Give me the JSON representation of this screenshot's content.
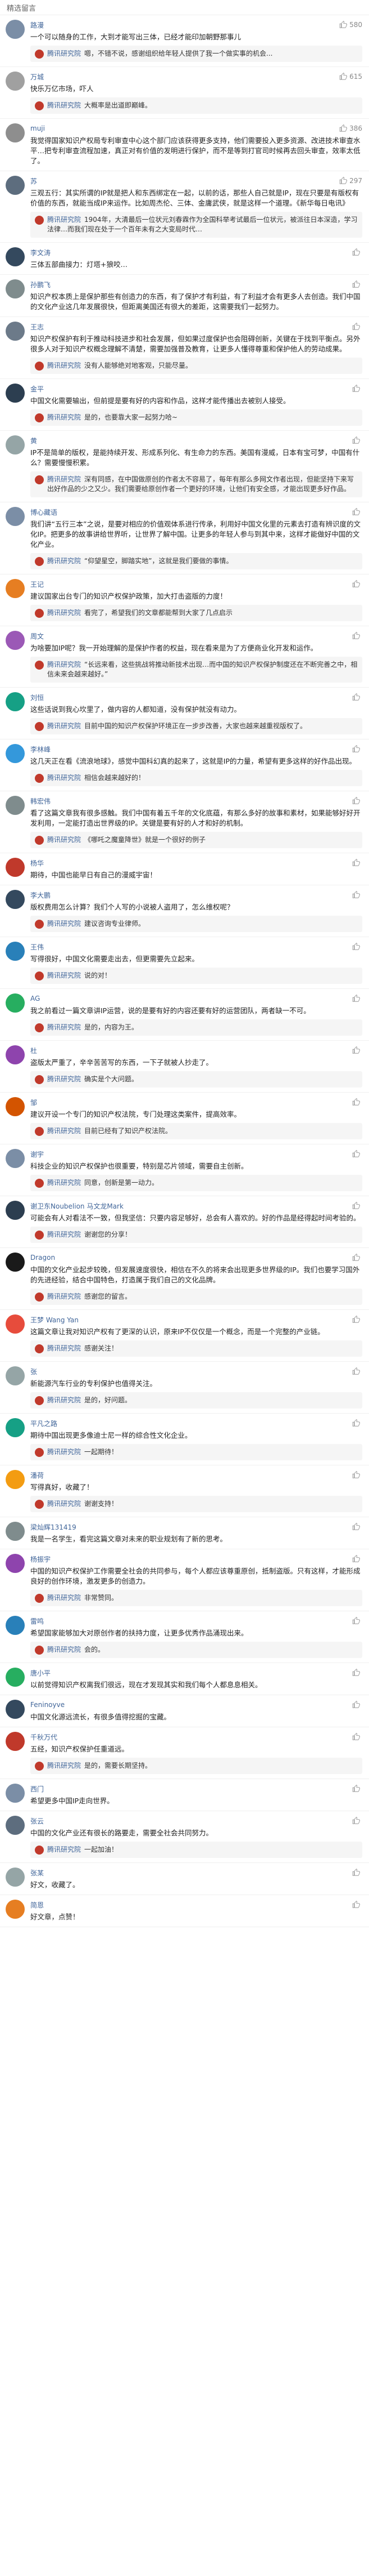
{
  "header": {
    "title": "精选留言"
  },
  "comments": [
    {
      "user": "路漫",
      "likes": "580",
      "text": "一个可以随身的工作，大到才能写出三体，已经才能印加朝野那事儿",
      "avatar_color": "#7b8ea6",
      "replies": [
        {
          "name": "腾讯研究院",
          "badge": "",
          "text": "嗯，不错不说，感谢组织给年轻人提供了我一个做实事的机会...",
          "avatar_color": "#c0392b"
        }
      ]
    },
    {
      "user": "万城",
      "likes": "615",
      "text": "快乐万亿市场，吓人",
      "avatar_color": "#a0a0a0",
      "replies": [
        {
          "name": "腾讯研究院",
          "badge": "",
          "text": "大概率是出道即巅峰。",
          "avatar_color": "#c0392b"
        }
      ]
    },
    {
      "user": "muji",
      "likes": "386",
      "text": "我觉得国家知识产权局专利审查中心这个部门应该获得更多支持，他们需要投入更多资源、改进技术审查水平…把专利审查流程加速，真正对有价值的发明进行保护，而不是等到打官司时候再去回头审查，效率太低了。",
      "avatar_color": "#8e8e8e",
      "replies": []
    },
    {
      "user": "苏",
      "likes": "297",
      "text": "三观五行：其实所谓的IP就是把人和东西绑定在一起，以前的话，那些人自己就是IP，现在只要是有版权有价值的东西，就能当成IP来运作。比如周杰伦、三体、金庸武侠，就是这样一个道理。《新华每日电讯》",
      "avatar_color": "#5d6d7e",
      "replies": [
        {
          "name": "腾讯研究院",
          "badge": "",
          "text": "1904年，大清最后一位状元刘春霖作为全国科举考试最后一位状元，被派往日本深造，学习法律…而我们现在处于一个百年未有之大变局时代…",
          "avatar_color": "#c0392b"
        }
      ]
    },
    {
      "user": "李文涛",
      "likes": "",
      "text": "三体五部曲接力：灯塔+狼咬…",
      "avatar_color": "#34495e",
      "replies": []
    },
    {
      "user": "孙鹏飞",
      "likes": "",
      "text": "知识产权本质上是保护那些有创造力的东西，有了保护才有利益，有了利益才会有更多人去创造。我们中国的文化产业这几年发展很快，但距离美国还有很大的差距，这需要我们一起努力。",
      "avatar_color": "#7f8c8d",
      "replies": []
    },
    {
      "user": "王志",
      "likes": "",
      "text": "知识产权保护有利于推动科技进步和社会发展，但如果过度保护也会阻碍创新，关键在于找到平衡点。另外很多人对于知识产权概念理解不清楚，需要加强普及教育，让更多人懂得尊重和保护他人的劳动成果。",
      "avatar_color": "#6c7a89",
      "replies": [
        {
          "name": "腾讯研究院",
          "badge": "",
          "text": "没有人能够绝对地客观，只能尽量。",
          "avatar_color": "#c0392b"
        }
      ]
    },
    {
      "user": "金平",
      "likes": "",
      "text": "中国文化需要输出，但前提是要有好的内容和作品，这样才能传播出去被别人接受。",
      "avatar_color": "#2c3e50",
      "replies": [
        {
          "name": "腾讯研究院",
          "badge": "",
          "text": "是的，也要靠大家一起努力哈~",
          "avatar_color": "#c0392b"
        }
      ]
    },
    {
      "user": "黄",
      "likes": "",
      "text": "IP不是简单的版权，是能持续开发、形成系列化、有生命力的东西。美国有漫威，日本有宝可梦，中国有什么？需要慢慢积累。",
      "avatar_color": "#95a5a6",
      "replies": [
        {
          "name": "腾讯研究院",
          "badge": "",
          "text": "深有同感，在中国做原创的作者太不容易了，每年有那么多网文作者出现，但能坚持下来写出好作品的少之又少。我们需要给原创作者一个更好的环境，让他们有安全感，才能出现更多好作品。",
          "avatar_color": "#c0392b"
        }
      ]
    },
    {
      "user": "博心藏语",
      "likes": "",
      "text": "我们讲“五行三本”之说，是要对相应的价值观体系进行传承，利用好中国文化里的元素去打造有辨识度的文化IP。把更多的故事讲给世界听，让世界了解中国。让更多的年轻人参与到其中来，这样才能做好中国的文化产业。",
      "avatar_color": "#7b8ea6",
      "replies": [
        {
          "name": "腾讯研究院",
          "badge": "",
          "text": "“仰望星空，脚踏实地”，这就是我们要做的事情。",
          "avatar_color": "#c0392b"
        }
      ]
    },
    {
      "user": "王记",
      "likes": "",
      "text": "建议国家出台专门的知识产权保护政策，加大打击盗版的力度！",
      "avatar_color": "#e67e22",
      "replies": [
        {
          "name": "腾讯研究院",
          "badge": "",
          "text": "看完了，希望我们的文章都能帮到大家了几点启示",
          "avatar_color": "#c0392b"
        }
      ]
    },
    {
      "user": "周文",
      "likes": "",
      "text": "为啥要加IP呢？我一开始理解的是保护作者的权益，现在看来是为了方便商业化开发和运作。",
      "avatar_color": "#9b59b6",
      "replies": [
        {
          "name": "腾讯研究院",
          "badge": "",
          "text": "“长远来看，这些挑战将推动新技术出现…而中国的知识产权保护制度还在不断完善之中，相信未来会越来越好。”",
          "avatar_color": "#c0392b"
        }
      ]
    },
    {
      "user": "刘恒",
      "likes": "",
      "text": "这些话说到我心坎里了，做内容的人都知道，没有保护就没有动力。",
      "avatar_color": "#16a085",
      "replies": [
        {
          "name": "腾讯研究院",
          "badge": "",
          "text": "目前中国的知识产权保护环境正在一步步改善，大家也越来越重视版权了。",
          "avatar_color": "#c0392b"
        }
      ]
    },
    {
      "user": "李林峰",
      "likes": "",
      "text": "这几天正在看《流浪地球》，感觉中国科幻真的起来了，这就是IP的力量，希望有更多这样的好作品出现。",
      "avatar_color": "#3498db",
      "replies": [
        {
          "name": "腾讯研究院",
          "badge": "",
          "text": "相信会越来越好的！",
          "avatar_color": "#c0392b"
        }
      ]
    },
    {
      "user": "韩宏伟",
      "likes": "",
      "text": "看了这篇文章我有很多感触。我们中国有着五千年的文化底蕴，有那么多好的故事和素材，如果能够好好开发利用，一定能打造出世界级的IP。关键是要有好的人才和好的机制。",
      "avatar_color": "#7f8c8d",
      "replies": [
        {
          "name": "腾讯研究院",
          "badge": "",
          "text": "《哪吒之魔童降世》就是一个很好的例子",
          "avatar_color": "#c0392b"
        }
      ]
    },
    {
      "user": "杨华",
      "likes": "",
      "text": "期待，中国也能早日有自己的漫威宇宙！",
      "avatar_color": "#c0392b",
      "replies": []
    },
    {
      "user": "李大鹏",
      "likes": "",
      "text": "版权费用怎么计算？我们个人写的小说被人盗用了，怎么维权呢？",
      "avatar_color": "#34495e",
      "replies": [
        {
          "name": "腾讯研究院",
          "badge": "",
          "text": "建议咨询专业律师。",
          "avatar_color": "#c0392b"
        }
      ]
    },
    {
      "user": "王伟",
      "likes": "",
      "text": "写得很好，中国文化需要走出去，但更需要先立起来。",
      "avatar_color": "#2980b9",
      "replies": [
        {
          "name": "腾讯研究院",
          "badge": "",
          "text": "说的对！",
          "avatar_color": "#c0392b"
        }
      ]
    },
    {
      "user": "AG",
      "likes": "",
      "text": "我之前看过一篇文章讲IP运营，说的是要有好的内容还要有好的运营团队，两者缺一不可。",
      "avatar_color": "#27ae60",
      "replies": [
        {
          "name": "腾讯研究院",
          "badge": "",
          "text": "是的，内容为王。",
          "avatar_color": "#c0392b"
        }
      ]
    },
    {
      "user": "杜",
      "likes": "",
      "text": "盗版太严重了，辛辛苦苦写的东西，一下子就被人抄走了。",
      "avatar_color": "#8e44ad",
      "replies": [
        {
          "name": "腾讯研究院",
          "badge": "",
          "text": "确实是个大问题。",
          "avatar_color": "#c0392b"
        }
      ]
    },
    {
      "user": "邹",
      "likes": "",
      "text": "建议开设一个专门的知识产权法院，专门处理这类案件，提高效率。",
      "avatar_color": "#d35400",
      "replies": [
        {
          "name": "腾讯研究院",
          "badge": "",
          "text": "目前已经有了知识产权法院。",
          "avatar_color": "#c0392b"
        }
      ]
    },
    {
      "user": "谢宇",
      "likes": "",
      "text": "科技企业的知识产权保护也很重要，特别是芯片领域，需要自主创新。",
      "avatar_color": "#7b8ea6",
      "replies": [
        {
          "name": "腾讯研究院",
          "badge": "",
          "text": "同意，创新是第一动力。",
          "avatar_color": "#c0392b"
        }
      ]
    },
    {
      "user": "谢卫东Noubelion 马文龙Mark",
      "likes": "",
      "text": "可能会有人对看法不一致，但我坚信：只要内容足够好，总会有人喜欢的。好的作品是经得起时间考验的。",
      "avatar_color": "#2c3e50",
      "replies": [
        {
          "name": "腾讯研究院",
          "badge": "",
          "text": "谢谢您的分享！",
          "avatar_color": "#c0392b"
        }
      ]
    },
    {
      "user": "Dragon",
      "likes": "",
      "text": "中国的文化产业起步较晚，但发展速度很快，相信在不久的将来会出现更多世界级的IP。我们也要学习国外的先进经验，结合中国特色，打造属于我们自己的文化品牌。",
      "avatar_color": "#1a1a1a",
      "replies": [
        {
          "name": "腾讯研究院",
          "badge": "",
          "text": "感谢您的留言。",
          "avatar_color": "#c0392b"
        }
      ]
    },
    {
      "user": "王梦 Wang Yan",
      "likes": "",
      "text": "这篇文章让我对知识产权有了更深的认识，原来IP不仅仅是一个概念，而是一个完整的产业链。",
      "avatar_color": "#e74c3c",
      "replies": [
        {
          "name": "腾讯研究院",
          "badge": "",
          "text": "感谢关注！",
          "avatar_color": "#c0392b"
        }
      ]
    },
    {
      "user": "张",
      "likes": "",
      "text": "新能源汽车行业的专利保护也值得关注。",
      "avatar_color": "#95a5a6",
      "replies": [
        {
          "name": "腾讯研究院",
          "badge": "",
          "text": "是的，好问题。",
          "avatar_color": "#c0392b"
        }
      ]
    },
    {
      "user": "平凡之路",
      "likes": "",
      "text": "期待中国出现更多像迪士尼一样的综合性文化企业。",
      "avatar_color": "#16a085",
      "replies": [
        {
          "name": "腾讯研究院",
          "badge": "",
          "text": "一起期待！",
          "avatar_color": "#c0392b"
        }
      ]
    },
    {
      "user": "潘荷",
      "likes": "",
      "text": "写得真好，收藏了！",
      "avatar_color": "#f39c12",
      "replies": [
        {
          "name": "腾讯研究院",
          "badge": "",
          "text": "谢谢支持！",
          "avatar_color": "#c0392b"
        }
      ]
    },
    {
      "user": "梁灿辉131419",
      "likes": "",
      "text": "我是一名学生，看完这篇文章对未来的职业规划有了新的思考。",
      "avatar_color": "#7f8c8d",
      "replies": []
    },
    {
      "user": "杨振宇",
      "likes": "",
      "text": "中国的知识产权保护工作需要全社会的共同参与，每个人都应该尊重原创，抵制盗版。只有这样，才能形成良好的创作环境，激发更多的创造力。",
      "avatar_color": "#8e44ad",
      "replies": [
        {
          "name": "腾讯研究院",
          "badge": "",
          "text": "非常赞同。",
          "avatar_color": "#c0392b"
        }
      ]
    },
    {
      "user": "雷鸣",
      "likes": "",
      "text": "希望国家能够加大对原创作者的扶持力度，让更多优秀作品涌现出来。",
      "avatar_color": "#2980b9",
      "replies": [
        {
          "name": "腾讯研究院",
          "badge": "",
          "text": "会的。",
          "avatar_color": "#c0392b"
        }
      ]
    },
    {
      "user": "唐小平",
      "likes": "",
      "text": "以前觉得知识产权离我们很远，现在才发现其实和我们每个人都息息相关。",
      "avatar_color": "#27ae60",
      "replies": []
    },
    {
      "user": "Feninoyve",
      "likes": "",
      "text": "中国文化源远流长，有很多值得挖掘的宝藏。",
      "avatar_color": "#34495e",
      "replies": []
    },
    {
      "user": "千秋万代",
      "likes": "",
      "text": "五经，知识产权保护任重道远。",
      "avatar_color": "#c0392b",
      "replies": [
        {
          "name": "腾讯研究院",
          "badge": "",
          "text": "是的，需要长期坚持。",
          "avatar_color": "#c0392b"
        }
      ]
    },
    {
      "user": "西门",
      "likes": "",
      "text": "希望更多中国IP走向世界。",
      "avatar_color": "#7b8ea6",
      "replies": []
    },
    {
      "user": "张云",
      "likes": "",
      "text": "中国的文化产业还有很长的路要走，需要全社会共同努力。",
      "avatar_color": "#5d6d7e",
      "replies": [
        {
          "name": "腾讯研究院",
          "badge": "",
          "text": "一起加油！",
          "avatar_color": "#c0392b"
        }
      ]
    },
    {
      "user": "张某",
      "likes": "",
      "text": "好文，收藏了。",
      "avatar_color": "#95a5a6",
      "replies": []
    },
    {
      "user": "简恩",
      "likes": "",
      "text": "好文章，点赞！",
      "avatar_color": "#e67e22",
      "replies": []
    }
  ]
}
